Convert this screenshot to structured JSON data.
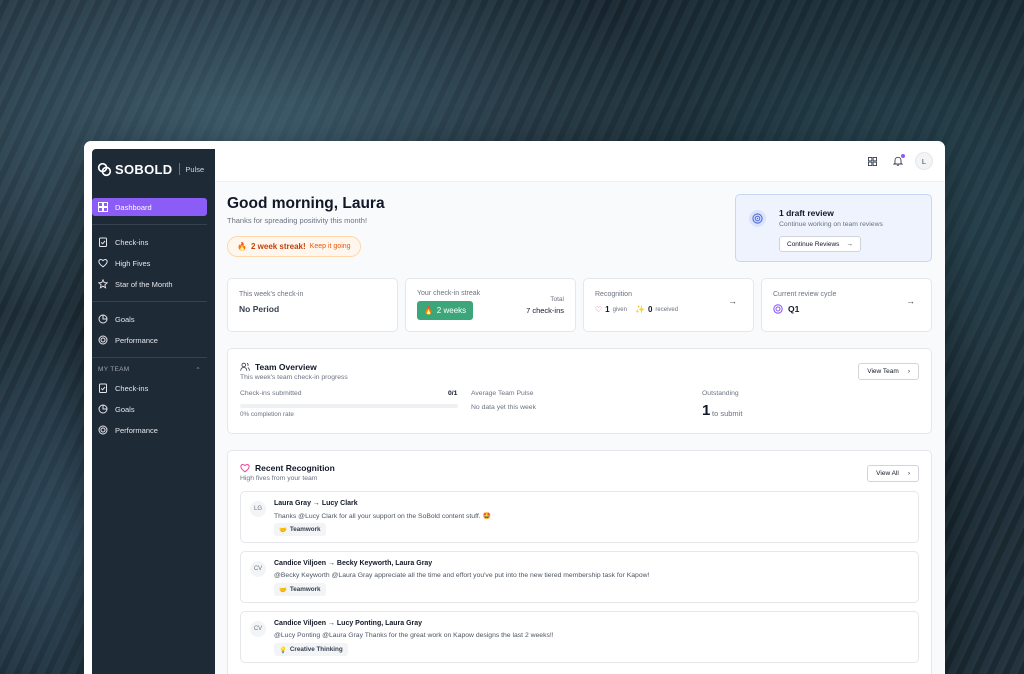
{
  "brand": {
    "name": "SOBOLD",
    "product": "Pulse"
  },
  "sidebar": {
    "items": [
      {
        "label": "Dashboard"
      },
      {
        "label": "Check-ins"
      },
      {
        "label": "High Fives"
      },
      {
        "label": "Star of the Month"
      },
      {
        "label": "Goals"
      },
      {
        "label": "Performance"
      }
    ],
    "team_section": "MY TEAM",
    "team_items": [
      {
        "label": "Check-ins"
      },
      {
        "label": "Goals"
      },
      {
        "label": "Performance"
      }
    ]
  },
  "topbar": {
    "avatar_initial": "L"
  },
  "header": {
    "greeting": "Good morning, Laura",
    "subtitle": "Thanks for spreading positivity this month!",
    "streak_label": "2 week streak!",
    "streak_cta": "Keep it going"
  },
  "draft": {
    "title": "1 draft review",
    "subtitle": "Continue working on team reviews",
    "button": "Continue Reviews"
  },
  "stats": {
    "checkin": {
      "label": "This week's check-in",
      "value": "No Period"
    },
    "streak": {
      "label": "Your check-in streak",
      "badge": "2 weeks",
      "total_label": "Total",
      "total_value": "7 check-ins"
    },
    "recognition": {
      "label": "Recognition",
      "given_count": "1",
      "given_label": "given",
      "received_count": "0",
      "received_label": "received"
    },
    "review_cycle": {
      "label": "Current review cycle",
      "value": "Q1"
    }
  },
  "team_overview": {
    "title": "Team Overview",
    "subtitle": "This week's team check-in progress",
    "button": "View Team",
    "checkins_label": "Check-ins submitted",
    "checkins_value": "0/1",
    "completion": "0% completion rate",
    "pulse_label": "Average Team Pulse",
    "pulse_value": "No data yet this week",
    "outstanding_label": "Outstanding",
    "outstanding_count": "1",
    "outstanding_text": "to submit"
  },
  "recent_recognition": {
    "title": "Recent Recognition",
    "subtitle": "High fives from your team",
    "button": "View All",
    "items": [
      {
        "initials": "LG",
        "who": "Laura Gray → Lucy Clark",
        "message": "Thanks @Lucy Clark for all your support on the SoBold content stuff. 🤩",
        "tag_icon": "🤝",
        "tag": "Teamwork"
      },
      {
        "initials": "CV",
        "who": "Candice Viljoen → Becky Keyworth, Laura Gray",
        "message": "@Becky Keyworth @Laura Gray appreciate all the time and effort you've put into the new tiered membership task for Kapow!",
        "tag_icon": "🤝",
        "tag": "Teamwork"
      },
      {
        "initials": "CV",
        "who": "Candice Viljoen → Lucy Ponting, Laura Gray",
        "message": "@Lucy Ponting @Laura Gray Thanks for the great work on Kapow designs the last 2 weeks!!",
        "tag_icon": "💡",
        "tag": "Creative Thinking"
      }
    ]
  },
  "colors": {
    "accent": "#8b5cf6",
    "sidebar_bg": "#1f2a37",
    "streak_green": "#3aa679"
  }
}
